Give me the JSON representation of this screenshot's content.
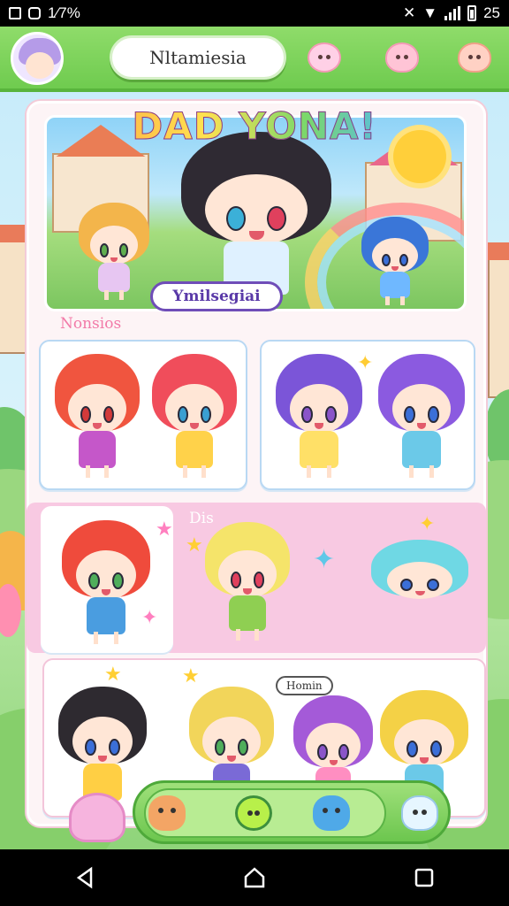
{
  "status_bar": {
    "left_text": "1⁄7%",
    "time": "25"
  },
  "header": {
    "title": "Nltamiesia",
    "icons": [
      "lollipop-icon",
      "pink-blob-icon",
      "peach-blob-icon"
    ]
  },
  "banner": {
    "title": "DAD YONA!",
    "sign": "Ymilsegiai"
  },
  "sections": {
    "first_label": "Nonsios",
    "second_label": "Dis"
  },
  "speech_bubble": "Homin",
  "dock": {
    "items": [
      "fox-pet",
      "smiley-pet",
      "blue-hair-character",
      "white-cat-pet"
    ]
  },
  "colors": {
    "brand_green": "#6fcb4f",
    "panel_pink": "#f8c9e2",
    "card_border": "#b9d8f3"
  }
}
